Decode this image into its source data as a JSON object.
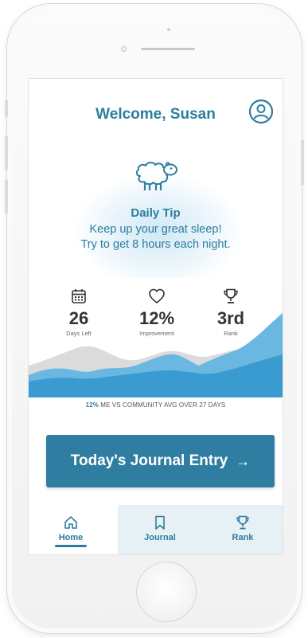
{
  "header": {
    "welcome_text": "Welcome, Susan"
  },
  "tip": {
    "title": "Daily Tip",
    "line1": "Keep up your great sleep!",
    "line2": "Try to get 8 hours each night."
  },
  "stats": [
    {
      "icon": "calendar-icon",
      "value": "26",
      "label": "Days Left"
    },
    {
      "icon": "heart-icon",
      "value": "12%",
      "label": "Improvement"
    },
    {
      "icon": "trophy-icon",
      "value": "3rd",
      "label": "Rank"
    }
  ],
  "comparison": {
    "highlight": "12%",
    "text": " ME VS COMMUNITY AVG OVER 27 DAYS"
  },
  "journal_button": {
    "label": "Today's Journal Entry",
    "arrow": "→"
  },
  "tabs": [
    {
      "label": "Home",
      "icon": "home-icon",
      "active": true
    },
    {
      "label": "Journal",
      "icon": "bookmark-icon",
      "active": false
    },
    {
      "label": "Rank",
      "icon": "trophy-icon",
      "active": false
    }
  ],
  "colors": {
    "primary": "#2c7da0",
    "button": "#2f7ea2",
    "tab_background": "#e6f0f5",
    "wave_light": "#4aa8d8",
    "wave_gray": "#9a9a9a"
  }
}
